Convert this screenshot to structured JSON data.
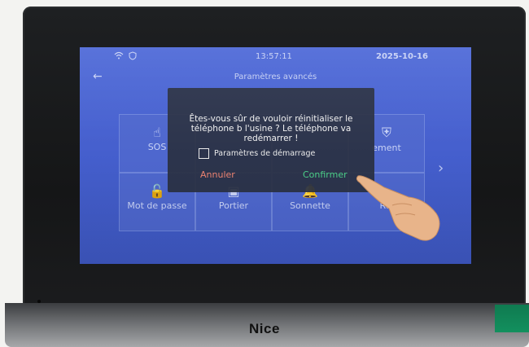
{
  "device": {
    "brand": "Nice"
  },
  "status_bar": {
    "time": "13:57:11",
    "date": "2025-10-16",
    "icons": [
      "wifi-icon",
      "shield-icon"
    ]
  },
  "screen": {
    "title": "Paramètres avancés",
    "back_icon": "back-arrow-icon",
    "next_icon": "chevron-right-icon",
    "tiles": [
      {
        "label": "SOS",
        "icon": "hand-tap-icon"
      },
      {
        "label": "",
        "icon": ""
      },
      {
        "label": "",
        "icon": ""
      },
      {
        "label": "ement",
        "icon": "shield-icon"
      },
      {
        "label": "Mot de passe",
        "icon": "lock-icon"
      },
      {
        "label": "Portier",
        "icon": "intercom-icon"
      },
      {
        "label": "Sonnette",
        "icon": "bell-icon"
      },
      {
        "label": "Réi",
        "icon": ""
      }
    ]
  },
  "dialog": {
    "message": "Êtes-vous sûr de vouloir réinitialiser le téléphone b l'usine ? Le téléphone va redémarrer !",
    "checkbox_label": "Paramètres de démarrage",
    "checkbox_checked": false,
    "cancel_label": "Annuler",
    "confirm_label": "Confirmer",
    "colors": {
      "cancel": "#ef8472",
      "confirm": "#4cd18a"
    }
  }
}
